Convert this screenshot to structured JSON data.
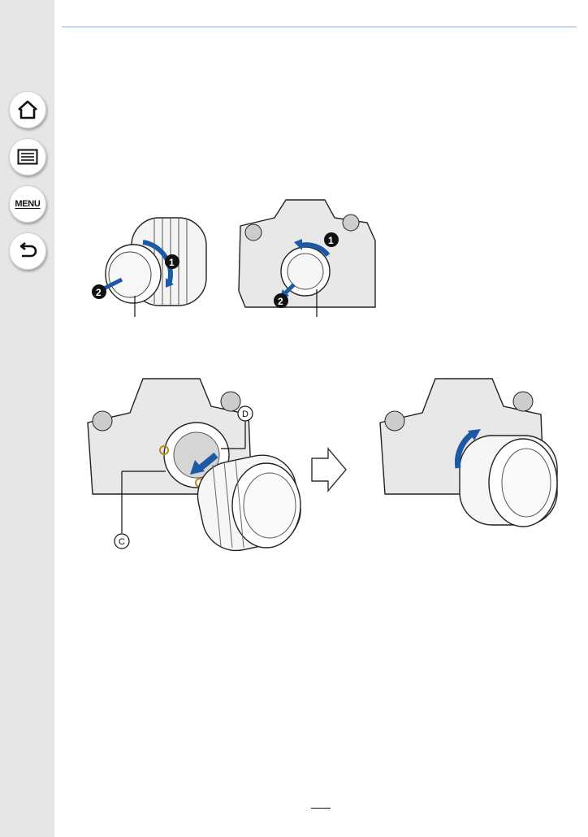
{
  "sidebar": {
    "items": [
      {
        "name": "home",
        "icon": "home-icon"
      },
      {
        "name": "contents",
        "icon": "list-icon"
      },
      {
        "name": "menu",
        "label": "MENU"
      },
      {
        "name": "back",
        "icon": "back-arrow-icon"
      }
    ]
  },
  "figure_top": {
    "lens_steps": [
      "1",
      "2"
    ],
    "body_steps": [
      "1",
      "2"
    ]
  },
  "figure_bottom": {
    "callouts": [
      "C",
      "D"
    ]
  },
  "colors": {
    "accent_arrow": "#1d5aa6",
    "sidebar_bg": "#e6e6e6",
    "rule": "#c9d7ea"
  }
}
